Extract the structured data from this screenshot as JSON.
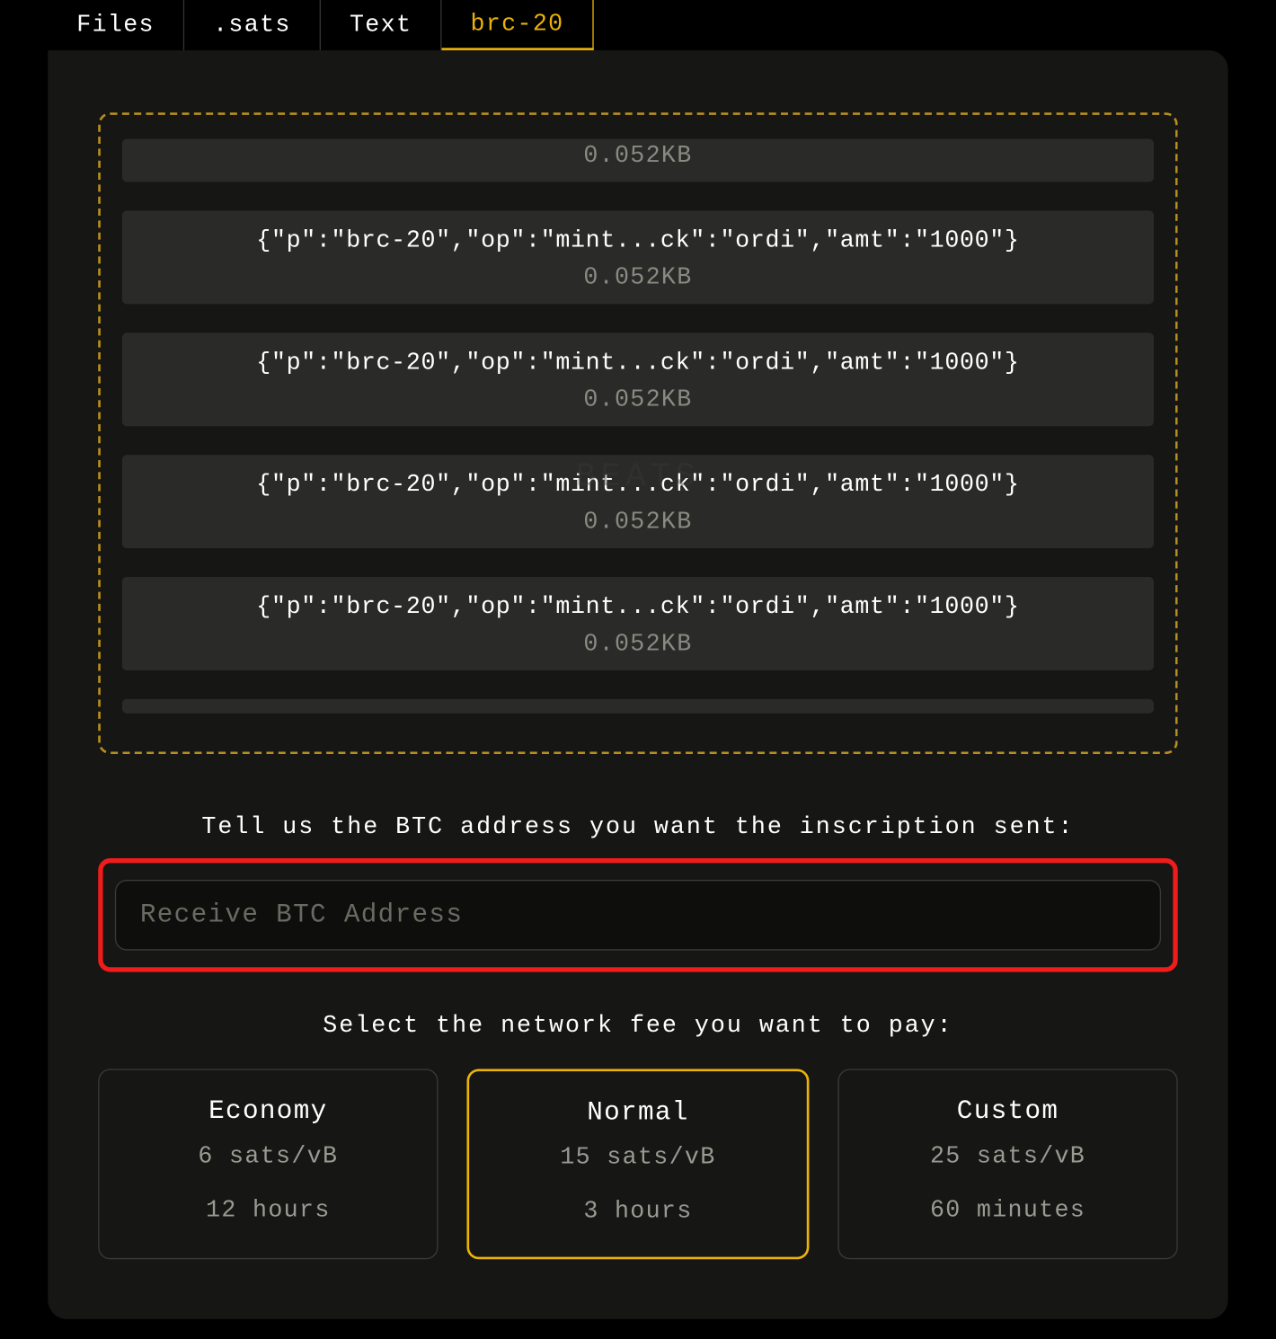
{
  "tabs": {
    "items": [
      {
        "label": "Files",
        "active": false
      },
      {
        "label": ".sats",
        "active": false
      },
      {
        "label": "Text",
        "active": false
      },
      {
        "label": "brc-20",
        "active": true
      }
    ]
  },
  "inscriptions": {
    "partial_top_size": "0.052KB",
    "items": [
      {
        "json": "{\"p\":\"brc-20\",\"op\":\"mint...ck\":\"ordi\",\"amt\":\"1000\"}",
        "size": "0.052KB"
      },
      {
        "json": "{\"p\":\"brc-20\",\"op\":\"mint...ck\":\"ordi\",\"amt\":\"1000\"}",
        "size": "0.052KB"
      },
      {
        "json": "{\"p\":\"brc-20\",\"op\":\"mint...ck\":\"ordi\",\"amt\":\"1000\"}",
        "size": "0.052KB"
      },
      {
        "json": "{\"p\":\"brc-20\",\"op\":\"mint...ck\":\"ordi\",\"amt\":\"1000\"}",
        "size": "0.052KB"
      }
    ]
  },
  "watermark": "BEATS",
  "address_section": {
    "prompt": "Tell us the BTC address you want the inscription sent:",
    "placeholder": "Receive BTC Address",
    "value": ""
  },
  "fee_section": {
    "prompt": "Select the network fee you want to pay:",
    "options": [
      {
        "name": "Economy",
        "rate": "6 sats/vB",
        "time": "12 hours",
        "selected": false
      },
      {
        "name": "Normal",
        "rate": "15 sats/vB",
        "time": "3 hours",
        "selected": true
      },
      {
        "name": "Custom",
        "rate": "25 sats/vB",
        "time": "60 minutes",
        "selected": false
      }
    ]
  },
  "colors": {
    "accent": "#eab308",
    "highlight": "#ef1c1c",
    "panel_bg": "#161614",
    "item_bg": "#2a2a28"
  }
}
